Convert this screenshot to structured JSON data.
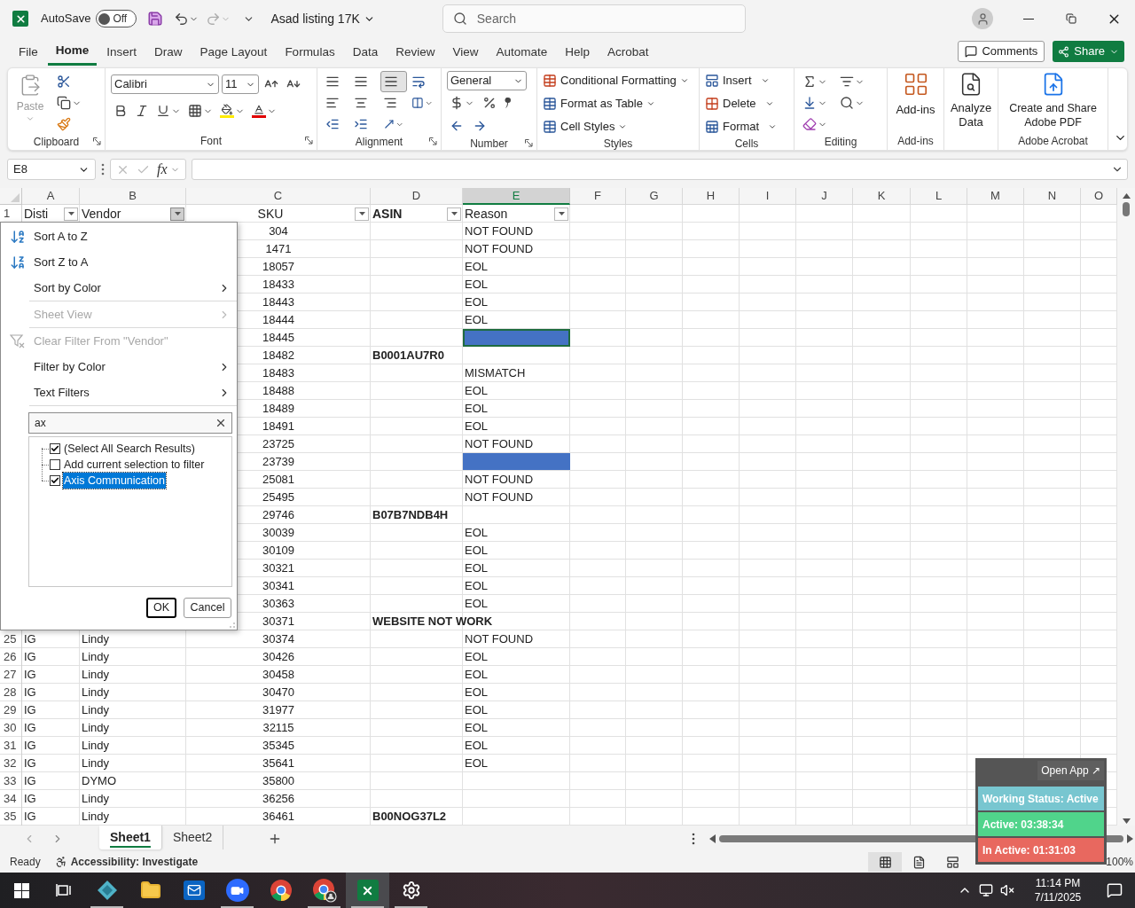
{
  "title_bar": {
    "autosave_label": "AutoSave",
    "autosave": {
      "on": false,
      "state_label": "Off"
    },
    "redo_disabled": true,
    "document_title": "Asad listing 17K",
    "search": {
      "placeholder": "Search"
    }
  },
  "ribbon_tabs": [
    {
      "label": "File",
      "selected": false
    },
    {
      "label": "Home",
      "selected": true
    },
    {
      "label": "Insert",
      "selected": false
    },
    {
      "label": "Draw",
      "selected": false
    },
    {
      "label": "Page Layout",
      "selected": false
    },
    {
      "label": "Formulas",
      "selected": false
    },
    {
      "label": "Data",
      "selected": false
    },
    {
      "label": "Review",
      "selected": false
    },
    {
      "label": "View",
      "selected": false
    },
    {
      "label": "Automate",
      "selected": false
    },
    {
      "label": "Help",
      "selected": false
    },
    {
      "label": "Acrobat",
      "selected": false
    }
  ],
  "ribbon_actions": {
    "comments": "Comments",
    "share": "Share"
  },
  "ribbon": {
    "clipboard": {
      "paste": "Paste",
      "paste_disabled": true,
      "label": "Clipboard"
    },
    "font": {
      "name": "Calibri",
      "size": "11",
      "label": "Font"
    },
    "alignment": {
      "bottom_align_selected": true,
      "label": "Alignment"
    },
    "number": {
      "format": "General",
      "label": "Number"
    },
    "styles": {
      "items": [
        "Conditional Formatting",
        "Format as Table",
        "Cell Styles"
      ],
      "label": "Styles"
    },
    "cells": {
      "items": [
        "Insert",
        "Delete",
        "Format"
      ],
      "label": "Cells"
    },
    "editing": {
      "label": "Editing"
    },
    "addins": {
      "button": "Add-ins",
      "label": "Add-ins"
    },
    "analyze": {
      "button": "Analyze Data"
    },
    "acrobat": {
      "button": "Create and Share Adobe PDF",
      "label": "Adobe Acrobat"
    }
  },
  "formula_bar": {
    "cell_ref": "E8",
    "function_label": "fx"
  },
  "columns": [
    {
      "letter": "A",
      "selected": false
    },
    {
      "letter": "B",
      "selected": false
    },
    {
      "letter": "C",
      "selected": false
    },
    {
      "letter": "D",
      "selected": false
    },
    {
      "letter": "E",
      "selected": true
    },
    {
      "letter": "F",
      "selected": false
    },
    {
      "letter": "G",
      "selected": false
    },
    {
      "letter": "H",
      "selected": false
    },
    {
      "letter": "I",
      "selected": false
    },
    {
      "letter": "J",
      "selected": false
    },
    {
      "letter": "K",
      "selected": false
    },
    {
      "letter": "L",
      "selected": false
    },
    {
      "letter": "M",
      "selected": false
    },
    {
      "letter": "N",
      "selected": false
    },
    {
      "letter": "O",
      "selected": false
    }
  ],
  "header_row": {
    "num": "1",
    "cells": [
      {
        "text": "Disti",
        "bold": false,
        "filter_open": false
      },
      {
        "text": "Vendor",
        "bold": false,
        "filter_open": true
      },
      {
        "text": "SKU",
        "bold": false,
        "filter_open": false
      },
      {
        "text": "ASIN",
        "bold": true,
        "filter_open": false
      },
      {
        "text": "Reason",
        "bold": false,
        "filter_open": false
      }
    ]
  },
  "rows": [
    {
      "sku": "304",
      "reason": "NOT FOUND",
      "highlighted": false,
      "active": false
    },
    {
      "sku": "1471",
      "reason": "NOT FOUND",
      "highlighted": false,
      "active": false
    },
    {
      "sku": "18057",
      "reason": "EOL",
      "highlighted": false,
      "active": false
    },
    {
      "sku": "18433",
      "reason": "EOL",
      "highlighted": false,
      "active": false
    },
    {
      "sku": "18443",
      "reason": "EOL",
      "highlighted": false,
      "active": false
    },
    {
      "sku": "18444",
      "reason": "EOL",
      "highlighted": false,
      "active": false
    },
    {
      "sku": "18445",
      "highlighted": true,
      "active": true
    },
    {
      "sku": "18482",
      "asin": "B0001AU7R0",
      "highlighted": false,
      "active": false
    },
    {
      "sku": "18483",
      "reason": "MISMATCH",
      "highlighted": false,
      "active": false
    },
    {
      "sku": "18488",
      "reason": "EOL",
      "highlighted": false,
      "active": false
    },
    {
      "sku": "18489",
      "reason": "EOL",
      "highlighted": false,
      "active": false
    },
    {
      "sku": "18491",
      "reason": "EOL",
      "highlighted": false,
      "active": false
    },
    {
      "sku": "23725",
      "reason": "NOT FOUND",
      "highlighted": false,
      "active": false
    },
    {
      "sku": "23739",
      "highlighted": true,
      "active": false
    },
    {
      "sku": "25081",
      "reason": "NOT FOUND",
      "highlighted": false,
      "active": false
    },
    {
      "sku": "25495",
      "reason": "NOT FOUND",
      "highlighted": false,
      "active": false
    },
    {
      "sku": "29746",
      "asin": "B07B7NDB4H",
      "highlighted": false,
      "active": false
    },
    {
      "sku": "30039",
      "reason": "EOL",
      "highlighted": false,
      "active": false
    },
    {
      "sku": "30109",
      "reason": "EOL",
      "highlighted": false,
      "active": false
    },
    {
      "sku": "30321",
      "reason": "EOL",
      "highlighted": false,
      "active": false
    },
    {
      "sku": "30341",
      "reason": "EOL",
      "highlighted": false,
      "active": false
    },
    {
      "sku": "30363",
      "reason": "EOL",
      "highlighted": false,
      "active": false
    },
    {
      "sku": "30371",
      "asin": "WEBSITE NOT WORK",
      "highlighted": false,
      "active": false
    },
    {
      "num": "25",
      "disti": "IG",
      "vendor": "Lindy",
      "sku": "30374",
      "reason": "NOT FOUND",
      "highlighted": false,
      "active": false
    },
    {
      "num": "26",
      "disti": "IG",
      "vendor": "Lindy",
      "sku": "30426",
      "reason": "EOL",
      "highlighted": false,
      "active": false
    },
    {
      "num": "27",
      "disti": "IG",
      "vendor": "Lindy",
      "sku": "30458",
      "reason": "EOL",
      "highlighted": false,
      "active": false
    },
    {
      "num": "28",
      "disti": "IG",
      "vendor": "Lindy",
      "sku": "30470",
      "reason": "EOL",
      "highlighted": false,
      "active": false
    },
    {
      "num": "29",
      "disti": "IG",
      "vendor": "Lindy",
      "sku": "31977",
      "reason": "EOL",
      "highlighted": false,
      "active": false
    },
    {
      "num": "30",
      "disti": "IG",
      "vendor": "Lindy",
      "sku": "32115",
      "reason": "EOL",
      "highlighted": false,
      "active": false
    },
    {
      "num": "31",
      "disti": "IG",
      "vendor": "Lindy",
      "sku": "35345",
      "reason": "EOL",
      "highlighted": false,
      "active": false
    },
    {
      "num": "32",
      "disti": "IG",
      "vendor": "Lindy",
      "sku": "35641",
      "reason": "EOL",
      "highlighted": false,
      "active": false
    },
    {
      "num": "33",
      "disti": "IG",
      "vendor": "DYMO",
      "sku": "35800",
      "highlighted": false,
      "active": false
    },
    {
      "num": "34",
      "disti": "IG",
      "vendor": "Lindy",
      "sku": "36256",
      "highlighted": false,
      "active": false
    },
    {
      "num": "35",
      "disti": "IG",
      "vendor": "Lindy",
      "sku": "36461",
      "asin": "B00NOG37L2",
      "highlighted": false,
      "active": false
    }
  ],
  "filter_menu": {
    "items": [
      {
        "kind": "sort_az",
        "label": "Sort A to Z",
        "disabled": false,
        "submenu": false,
        "separator_after": false
      },
      {
        "kind": "sort_za",
        "label": "Sort Z to A",
        "disabled": false,
        "submenu": false,
        "separator_after": false
      },
      {
        "kind": "plain",
        "label": "Sort by Color",
        "disabled": false,
        "submenu": true,
        "separator_after": true
      },
      {
        "kind": "plain",
        "label": "Sheet View",
        "disabled": true,
        "submenu": true,
        "separator_after": true
      },
      {
        "kind": "clear",
        "label": "Clear Filter From \"Vendor\"",
        "disabled": true,
        "submenu": false,
        "separator_after": false
      },
      {
        "kind": "plain",
        "label": "Filter by Color",
        "disabled": false,
        "submenu": true,
        "separator_after": false
      },
      {
        "kind": "plain",
        "label": "Text Filters",
        "disabled": false,
        "submenu": true,
        "separator_after": true
      }
    ],
    "search": {
      "value": "ax"
    },
    "list": [
      {
        "label": "(Select All Search Results)",
        "checked": true,
        "selected": false
      },
      {
        "label": "Add current selection to filter",
        "checked": false,
        "selected": false
      },
      {
        "label": "Axis Communication",
        "checked": true,
        "selected": true
      }
    ],
    "buttons": [
      {
        "label": "OK",
        "default": true
      },
      {
        "label": "Cancel",
        "default": false
      }
    ]
  },
  "sheet_tabs": [
    {
      "label": "Sheet1",
      "selected": true
    },
    {
      "label": "Sheet2",
      "selected": false
    }
  ],
  "status_bar": {
    "status": "Ready",
    "accessibility": "Accessibility: Investigate",
    "views": [
      {
        "kind": "normal",
        "selected": true
      },
      {
        "kind": "page_layout",
        "selected": false
      },
      {
        "kind": "page_break",
        "selected": false
      }
    ],
    "zoom": "100%"
  },
  "tracker": {
    "open_app": "Open App ↗",
    "lines": [
      {
        "text": "Working Status: Active",
        "color": "#78c6d0"
      },
      {
        "text": "Active: 03:38:34",
        "color": "#50d48b"
      },
      {
        "text": "In Active: 01:31:03",
        "color": "#e8685f"
      }
    ]
  },
  "taskbar": {
    "apps": [
      {
        "kind": "diamond",
        "open": true,
        "active": false
      },
      {
        "kind": "folder",
        "open": false,
        "active": false
      },
      {
        "kind": "mail",
        "open": false,
        "active": false
      },
      {
        "kind": "video",
        "open": true,
        "active": false
      },
      {
        "kind": "browser",
        "open": false,
        "active": false
      },
      {
        "kind": "browser_profile",
        "open": true,
        "active": false
      },
      {
        "kind": "spreadsheet",
        "open": true,
        "active": true
      },
      {
        "kind": "gear",
        "open": true,
        "active": false
      }
    ],
    "time": "11:14 PM",
    "date": "7/11/2025"
  }
}
